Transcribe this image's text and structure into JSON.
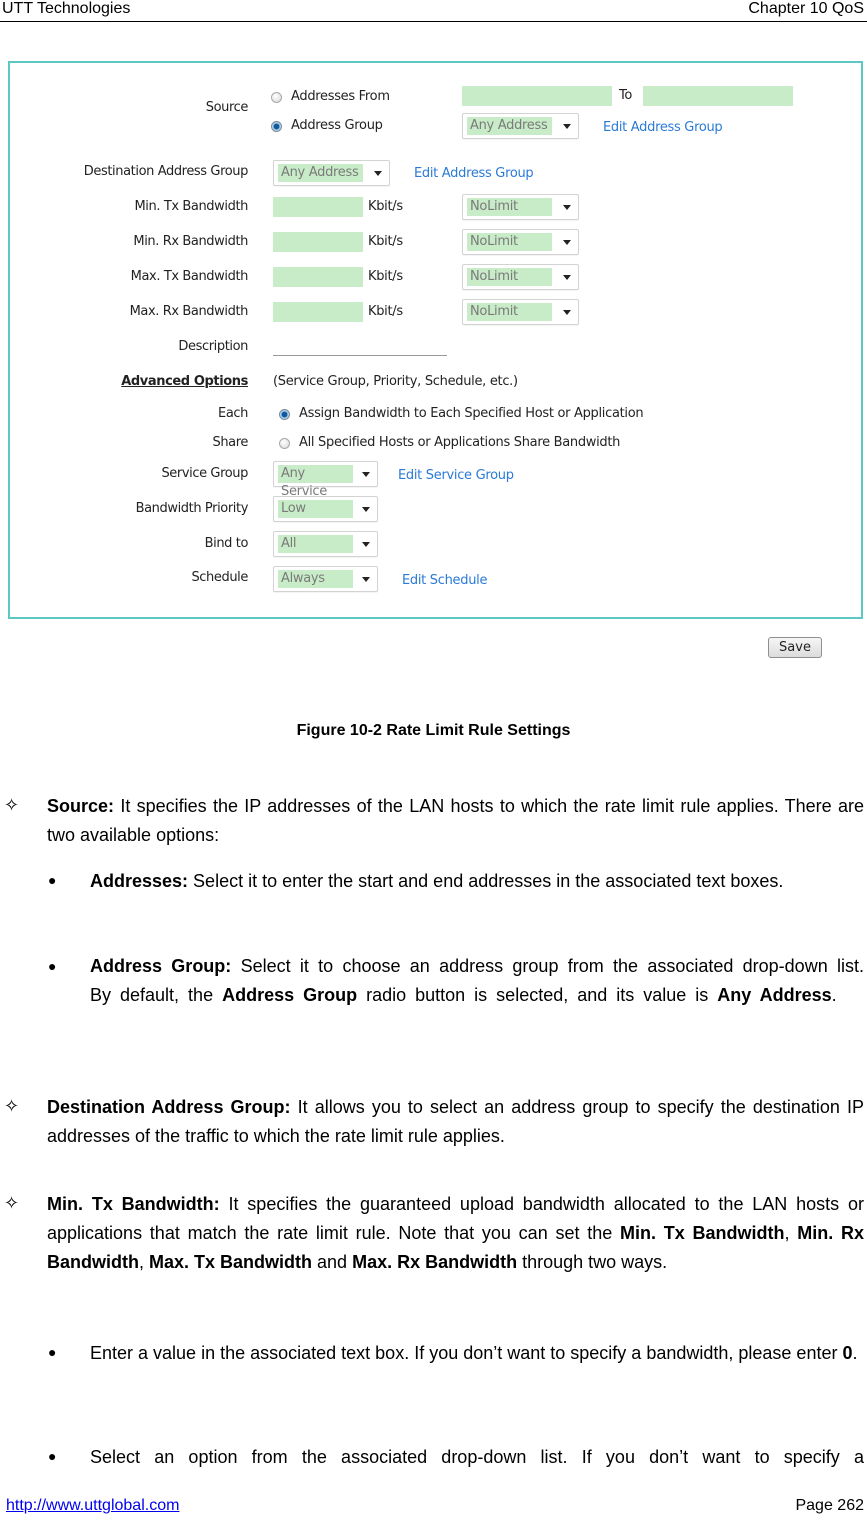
{
  "header": {
    "left": "UTT Technologies",
    "right": "Chapter 10 QoS"
  },
  "form": {
    "source": {
      "label": "Source",
      "option_range": "Addresses From",
      "option_group": "Address Group",
      "selected": "Address Group",
      "to_label": "To",
      "from_value": "",
      "to_value": "",
      "group_value": "Any Address",
      "edit_link": "Edit Address Group"
    },
    "destination": {
      "label": "Destination Address Group",
      "value": "Any Address",
      "edit_link": "Edit Address Group"
    },
    "bandwidth_rows": [
      {
        "label": "Min. Tx Bandwidth",
        "value": "",
        "unit": "Kbit/s",
        "select": "NoLimit"
      },
      {
        "label": "Min. Rx Bandwidth",
        "value": "",
        "unit": "Kbit/s",
        "select": "NoLimit"
      },
      {
        "label": "Max. Tx Bandwidth",
        "value": "",
        "unit": "Kbit/s",
        "select": "NoLimit"
      },
      {
        "label": "Max. Rx Bandwidth",
        "value": "",
        "unit": "Kbit/s",
        "select": "NoLimit"
      }
    ],
    "description": {
      "label": "Description",
      "value": ""
    },
    "advanced": {
      "label": "Advanced Options",
      "hint": "(Service Group, Priority, Schedule, etc.)"
    },
    "each": {
      "label": "Each",
      "text": "Assign Bandwidth to Each Specified Host or Application",
      "selected": true
    },
    "share": {
      "label": "Share",
      "text": "All Specified Hosts or Applications Share Bandwidth",
      "selected": false
    },
    "service_group": {
      "label": "Service Group",
      "value": "Any Service",
      "edit_link": "Edit Service Group"
    },
    "priority": {
      "label": "Bandwidth Priority",
      "value": "Low"
    },
    "bind_to": {
      "label": "Bind to",
      "value": "All"
    },
    "schedule": {
      "label": "Schedule",
      "value": "Always",
      "edit_link": "Edit Schedule"
    },
    "save_label": "Save"
  },
  "caption": "Figure 10-2 Rate Limit Rule Settings",
  "body": {
    "source": {
      "term": "Source:",
      "text": " It specifies the IP addresses of the LAN hosts to which the rate limit rule applies. There are two available options:"
    },
    "addresses": {
      "term": "Addresses:",
      "text": " Select it to enter the start and end addresses in the associated text boxes."
    },
    "address_group": {
      "term": "Address Group:",
      "text1": " Select it to choose an address group from the associated drop-down list. By default, the ",
      "bold1": "Address Group",
      "text2": " radio button is selected, and its value is ",
      "bold2": "Any Address",
      "text3": "."
    },
    "destination": {
      "term": "Destination Address Group:",
      "text": " It allows you to select an address group to specify the destination IP addresses of the traffic to which the rate limit rule applies."
    },
    "min_tx": {
      "term": "Min. Tx Bandwidth:",
      "text1": " It specifies the guaranteed upload bandwidth allocated to the LAN hosts or applications that match the rate limit rule. Note that you can set the ",
      "b1": "Min. Tx Bandwidth",
      "s1": ", ",
      "b2": "Min. Rx Bandwidth",
      "s2": ", ",
      "b3": "Max. Tx Bandwidth",
      "s3": " and ",
      "b4": "Max. Rx Bandwidth",
      "text2": " through two ways."
    },
    "way1": {
      "text": "Enter a value in the associated text box. If you don’t want to specify a bandwidth, please enter ",
      "bold": "0",
      "end": "."
    },
    "way2": {
      "text": "Select an option from the associated drop-down list. If you don’t want to specify a"
    }
  },
  "footer": {
    "link": "http://www.uttglobal.com",
    "page": "Page  262"
  },
  "glyphs": {
    "diamond": "✧",
    "bullet": "●"
  }
}
